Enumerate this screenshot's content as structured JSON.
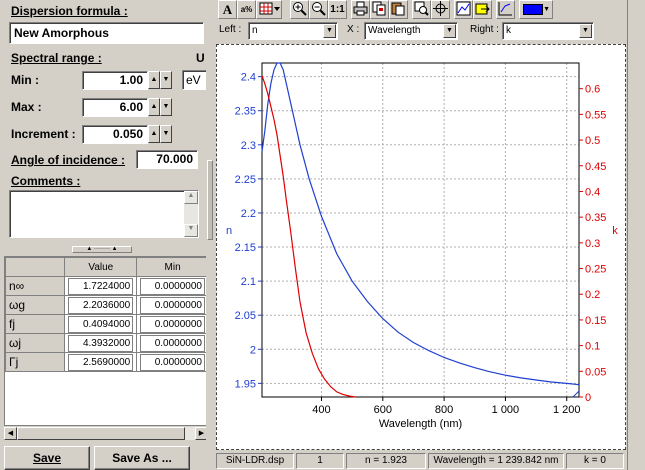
{
  "left": {
    "dispersion_label": "Dispersion formula :",
    "dispersion_value": "New Amorphous",
    "spectral_range_label": "Spectral range :",
    "spectral_unit_marker": "U",
    "min_label": "Min :",
    "min_value": "1.00",
    "max_label": "Max :",
    "max_value": "6.00",
    "increment_label": "Increment :",
    "increment_value": "0.050",
    "unit_value": "eV",
    "angle_label": "Angle of incidence :",
    "angle_value": "70.000",
    "comments_label": "Comments :",
    "table": {
      "columns": [
        "Value",
        "Min"
      ],
      "rows": [
        {
          "name": "n∞",
          "value": "1.7224000",
          "min": "0.0000000"
        },
        {
          "name": "ωg",
          "value": "2.2036000",
          "min": "0.0000000"
        },
        {
          "name": "fj",
          "value": "0.4094000",
          "min": "0.0000000"
        },
        {
          "name": "ωj",
          "value": "4.3932000",
          "min": "0.0000000"
        },
        {
          "name": "Γj",
          "value": "2.5690000",
          "min": "0.0000000"
        }
      ]
    },
    "save_label": "Save",
    "save_as_label": "Save As ..."
  },
  "toolbar": {
    "left_label": "Left :",
    "left_value": "n",
    "x_label": "X :",
    "x_value": "Wavelength",
    "right_label": "Right :",
    "right_value": "k",
    "buttons": [
      "A",
      "a%",
      "fill",
      "zoom-in",
      "zoom-out",
      "1:1",
      "print",
      "copy",
      "paste",
      "zoom-fit",
      "crosshair",
      "graph",
      "export",
      "plot",
      "color"
    ],
    "button_labels": {
      "font": "A",
      "one_to_one": "1:1"
    },
    "color_swatch": "#0000ff"
  },
  "status": {
    "file": "SiN-LDR.dsp",
    "index": "1",
    "n": "n = 1.923",
    "wavelength": "Wavelength = 1 239.842 nm",
    "k": "k = 0"
  },
  "colors": {
    "n_series": "#1f3fd0",
    "k_series": "#e00000"
  },
  "chart_data": {
    "type": "line",
    "xlabel": "Wavelength (nm)",
    "ylabel_left": "n",
    "ylabel_right": "k",
    "xlim": [
      206,
      1240
    ],
    "ylim_left": [
      1.93,
      2.42
    ],
    "ylim_right": [
      0,
      0.65
    ],
    "x_ticks": [
      "400",
      "600",
      "800",
      "1 000",
      "1 200"
    ],
    "x_tick_values": [
      400,
      600,
      800,
      1000,
      1200
    ],
    "y_left_ticks": [
      "1.95",
      "2",
      "2.05",
      "2.1",
      "2.15",
      "2.2",
      "2.25",
      "2.3",
      "2.35",
      "2.4"
    ],
    "y_left_tick_values": [
      1.95,
      2.0,
      2.05,
      2.1,
      2.15,
      2.2,
      2.25,
      2.3,
      2.35,
      2.4
    ],
    "y_right_ticks": [
      "0",
      "0.05",
      "0.1",
      "0.15",
      "0.2",
      "0.25",
      "0.3",
      "0.35",
      "0.4",
      "0.45",
      "0.5",
      "0.55",
      "0.6"
    ],
    "y_right_tick_values": [
      0,
      0.05,
      0.1,
      0.15,
      0.2,
      0.25,
      0.3,
      0.35,
      0.4,
      0.45,
      0.5,
      0.55,
      0.6
    ],
    "grid": true,
    "series": [
      {
        "name": "n",
        "axis": "left",
        "x": [
          206,
          215,
          225,
          235,
          245,
          255,
          265,
          275,
          290,
          310,
          330,
          360,
          400,
          450,
          500,
          550,
          600,
          650,
          700,
          750,
          800,
          850,
          900,
          950,
          1000,
          1050,
          1100,
          1150,
          1200,
          1240
        ],
        "y": [
          2.29,
          2.32,
          2.36,
          2.39,
          2.41,
          2.42,
          2.42,
          2.41,
          2.38,
          2.34,
          2.3,
          2.25,
          2.195,
          2.14,
          2.1,
          2.07,
          2.045,
          2.025,
          2.01,
          1.998,
          1.988,
          1.98,
          1.973,
          1.967,
          1.962,
          1.958,
          1.955,
          1.952,
          1.95,
          1.948
        ]
      },
      {
        "name": "k",
        "axis": "right",
        "x": [
          206,
          215,
          225,
          235,
          245,
          255,
          265,
          275,
          285,
          300,
          315,
          330,
          350,
          370,
          390,
          410,
          430,
          450,
          470,
          490,
          510
        ],
        "y": [
          0.625,
          0.61,
          0.59,
          0.565,
          0.54,
          0.51,
          0.47,
          0.43,
          0.385,
          0.32,
          0.25,
          0.185,
          0.125,
          0.085,
          0.055,
          0.035,
          0.02,
          0.01,
          0.005,
          0.002,
          0.0
        ]
      }
    ]
  }
}
